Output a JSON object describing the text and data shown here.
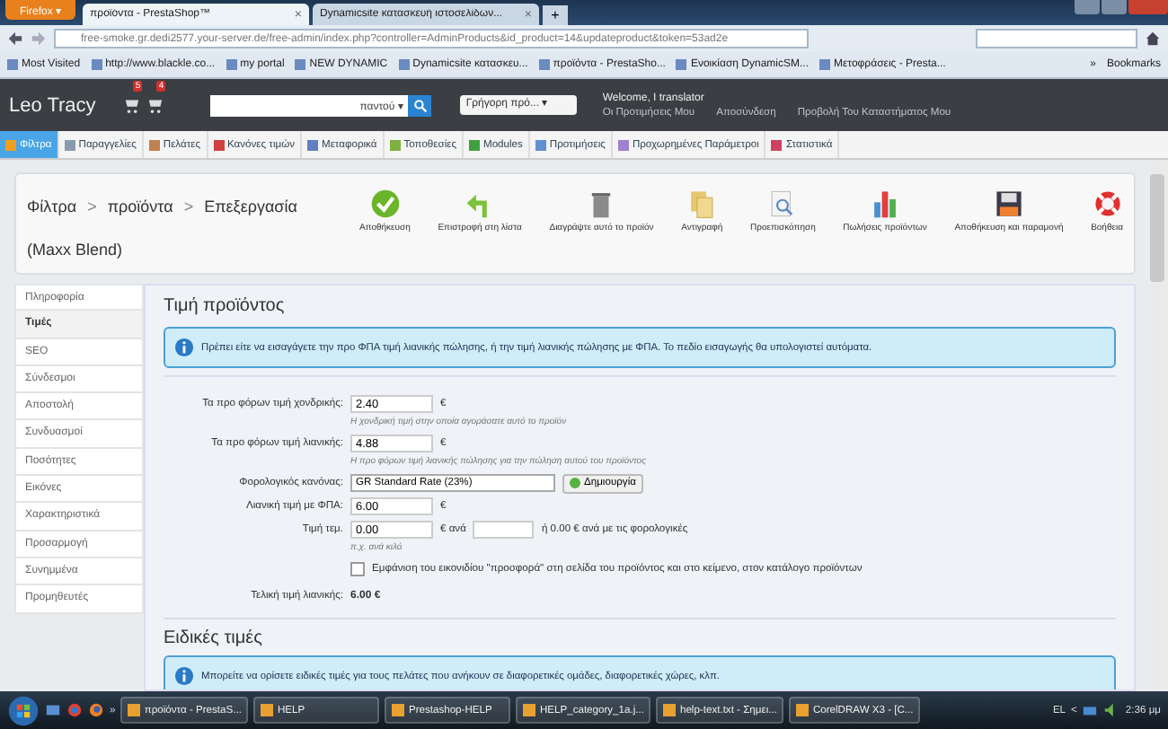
{
  "browser": {
    "menu_button": "Firefox ▾",
    "tabs": [
      {
        "title": "προϊόντα - PrestaShop™",
        "close": "×",
        "selected": true
      },
      {
        "title": "Dynamicsite κατασκευή ιστοσελίδων...",
        "close": "×",
        "selected": false
      }
    ],
    "new_tab": "+",
    "url": "free-smoke.gr.dedi2577.your-server.de/free-admin/index.php?controller=AdminProducts&id_product=14&updateproduct&token=53ad2e",
    "bookmarks": [
      "Most Visited",
      "http://www.blackle.co...",
      "my portal",
      "NEW DYNAMIC",
      "Dynamicsite κατασκευ...",
      "προϊόντα - PrestaSho...",
      "Ενοικίαση DynamicSM...",
      "Μετοφράσεις - Presta..."
    ],
    "more": "»",
    "bookmarks_menu": "Bookmarks"
  },
  "header": {
    "shop": "Leo Tracy",
    "badges": [
      "5",
      "4"
    ],
    "search_scope": "παντού ▾",
    "quick_access": "Γρήγορη πρό... ▾",
    "welcome": "Welcome, I translator",
    "links": [
      "Οι Προτιμήσεις Μου",
      "Αποσύνδεση",
      "Προβολή Του Καταστήματος Μου"
    ]
  },
  "menu": [
    {
      "label": "Φίλτρα",
      "selected": true
    },
    {
      "label": "Παραγγελίες",
      "selected": false
    },
    {
      "label": "Πελάτες",
      "selected": false
    },
    {
      "label": "Κανόνες τιμών",
      "selected": false
    },
    {
      "label": "Μεταφορικά",
      "selected": false
    },
    {
      "label": "Τοποθεσίες",
      "selected": false
    },
    {
      "label": "Modules",
      "selected": false
    },
    {
      "label": "Προτιμήσεις",
      "selected": false
    },
    {
      "label": "Προχωρημένες Παράμετροι",
      "selected": false
    },
    {
      "label": "Στατιστικά",
      "selected": false
    }
  ],
  "toolbar": {
    "breadcrumb": [
      "Φίλτρα",
      "προϊόντα",
      "Επεξεργασία"
    ],
    "separator": ">",
    "product": "(Maxx Blend)",
    "buttons": [
      {
        "kind": "save",
        "label": "Αποθήκευση"
      },
      {
        "kind": "back",
        "label": "Επιστροφή στη λίστα"
      },
      {
        "kind": "delete",
        "label": "Διαγράψτε αυτό το προϊόν"
      },
      {
        "kind": "copy",
        "label": "Αντιγραφή"
      },
      {
        "kind": "preview",
        "label": "Προεπισκόπηση"
      },
      {
        "kind": "sales",
        "label": "Πωλήσεις προϊόντων"
      },
      {
        "kind": "save_stay",
        "label": "Αποθήκευση και παραμονή"
      },
      {
        "kind": "help",
        "label": "Βοήθεια"
      }
    ]
  },
  "side_tabs": [
    {
      "label": "Πληροφορία",
      "selected": false
    },
    {
      "label": "Τιμές",
      "selected": true
    },
    {
      "label": "SEO",
      "selected": false
    },
    {
      "label": "Σύνδεσμοι",
      "selected": false
    },
    {
      "label": "Αποστολή",
      "selected": false
    },
    {
      "label": "Συνδυασμοί",
      "selected": false
    },
    {
      "label": "Ποσότητες",
      "selected": false
    },
    {
      "label": "Εικόνες",
      "selected": false
    },
    {
      "label": "Χαρακτηριστικά",
      "selected": false
    },
    {
      "label": "Προσαρμογή",
      "selected": false
    },
    {
      "label": "Συνημμένα",
      "selected": false
    },
    {
      "label": "Προμηθευτές",
      "selected": false
    }
  ],
  "price": {
    "title": "Τιμή προϊόντος",
    "info": "Πρέπει είτε να εισαγάγετε την προ ΦΠΑ τιμή λιανικής πώλησης, ή την τιμή λιανικής πώλησης με ΦΠΑ. Το πεδίο εισαγωγής θα υπολογιστεί αυτόματα.",
    "wholesale": {
      "label": "Τα προ φόρων τιμή χονδρικής:",
      "value": "2.40",
      "unit": "€",
      "hint": "Η χονδρική τιμή στην οποία αγοράσατε αυτό το προϊόν"
    },
    "retail": {
      "label": "Τα προ φόρων τιμή λιανικής:",
      "value": "4.88",
      "unit": "€",
      "hint": "Η προ φόρων τιμή λιανικής πώλησης για την πώληση αυτού του προϊόντος"
    },
    "tax": {
      "label": "Φορολογικός κανόνας:",
      "value": "GR Standard Rate (23%)",
      "button": "Δημιουργία"
    },
    "with_tax": {
      "label": "Λιανική τιμή με ΦΠΑ:",
      "value": "6.00",
      "unit": "€"
    },
    "unit_price": {
      "label": "Τιμή τεμ.",
      "value": "0.00",
      "per": "€ ανά",
      "result": "ή 0.00 € ανά με τις φορολογικές",
      "hint": "π.χ. ανά κιλό"
    },
    "on_sale": {
      "label": "Εμφάνιση του εικονιδίου \"προσφορά\" στη σελίδα του προϊόντος και στο κείμενο, στον κατάλογο προϊόντων",
      "checked": false
    },
    "final": {
      "label": "Τελική τιμή λιανικής:",
      "value": "6.00 €"
    }
  },
  "specific": {
    "title": "Ειδικές τιμές",
    "info": "Μπορείτε να ορίσετε ειδικές τιμές για τους πελάτες που ανήκουν σε διαφορετικές ομάδες, διαφορετικές χώρες, κλπ."
  },
  "taskbar": {
    "more": "»",
    "tasks": [
      "προϊόντα - PrestaS...",
      "HELP",
      "Prestashop-HELP",
      "HELP_category_1a.j...",
      "help-text.txt - Σημει...",
      "CorelDRAW X3 - [C..."
    ],
    "language": "EL",
    "tray_arrow": "<",
    "clock": "2:36 μμ"
  }
}
